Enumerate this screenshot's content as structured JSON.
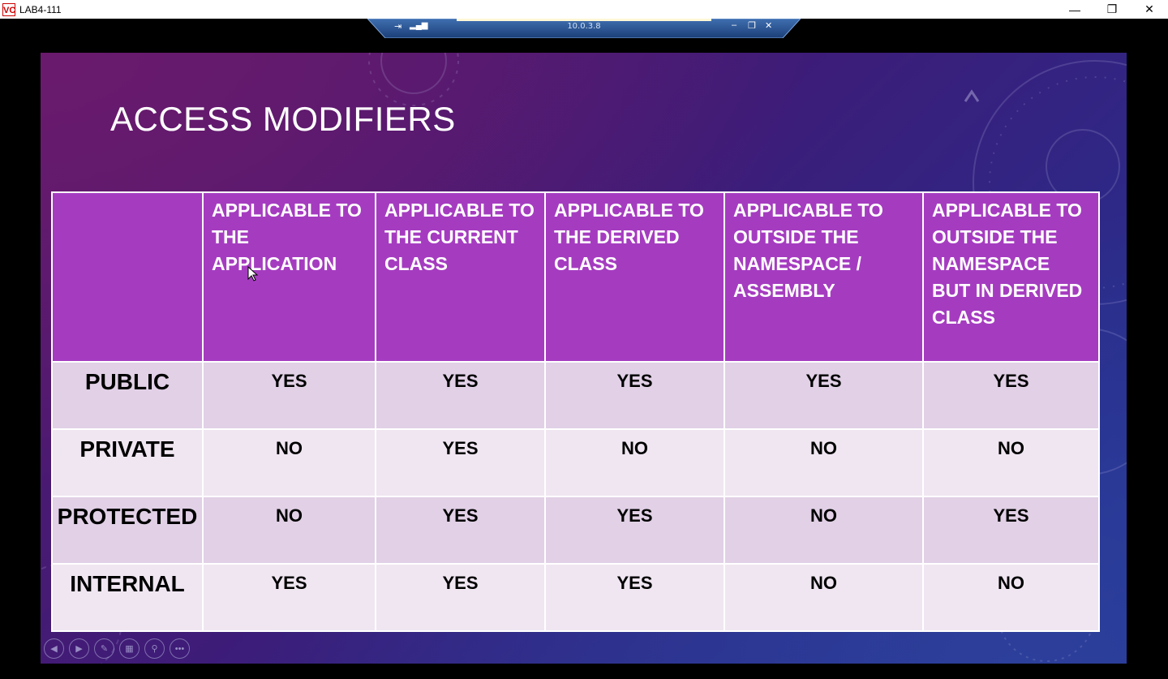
{
  "window": {
    "app_icon": "VC",
    "title": "LAB4-111",
    "minimize_icon": "—",
    "restore_icon": "❐",
    "close_icon": "✕"
  },
  "rdp_bar": {
    "ip": "10.0.3.8",
    "pin_icon": "⇥",
    "signal_icon": "▂▄▆",
    "minimize_icon": "–",
    "restore_icon": "❐",
    "close_icon": "✕"
  },
  "slide": {
    "title": "ACCESS MODIFIERS",
    "table": {
      "headers": [
        "",
        "APPLICABLE TO THE APPLICATION",
        "APPLICABLE TO THE CURRENT CLASS",
        "APPLICABLE TO THE DERIVED CLASS",
        "APPLICABLE TO OUTSIDE THE NAMESPACE / ASSEMBLY",
        "APPLICABLE TO OUTSIDE THE NAMESPACE BUT IN DERIVED CLASS"
      ],
      "rows": [
        {
          "modifier": "PUBLIC",
          "values": [
            "YES",
            "YES",
            "YES",
            "YES",
            "YES"
          ]
        },
        {
          "modifier": "PRIVATE",
          "values": [
            "NO",
            "YES",
            "NO",
            "NO",
            "NO"
          ]
        },
        {
          "modifier": "PROTECTED",
          "values": [
            "NO",
            "YES",
            "YES",
            "NO",
            "YES"
          ]
        },
        {
          "modifier": "INTERNAL",
          "values": [
            "YES",
            "YES",
            "YES",
            "NO",
            "NO"
          ]
        }
      ]
    }
  },
  "slideshow_controls": [
    {
      "name": "previous-slide-button",
      "icon": "◀"
    },
    {
      "name": "next-slide-button",
      "icon": "▶"
    },
    {
      "name": "pen-tool-button",
      "icon": "✎"
    },
    {
      "name": "see-all-slides-button",
      "icon": "▦"
    },
    {
      "name": "zoom-button",
      "icon": "⚲"
    },
    {
      "name": "more-options-button",
      "icon": "•••"
    }
  ],
  "colors": {
    "header_fill": "#a53cc0",
    "row_dark": "#e1d0e6",
    "row_light": "#f0e6f2",
    "slide_bg_start": "#5a186a",
    "slide_bg_end": "#23349a"
  }
}
